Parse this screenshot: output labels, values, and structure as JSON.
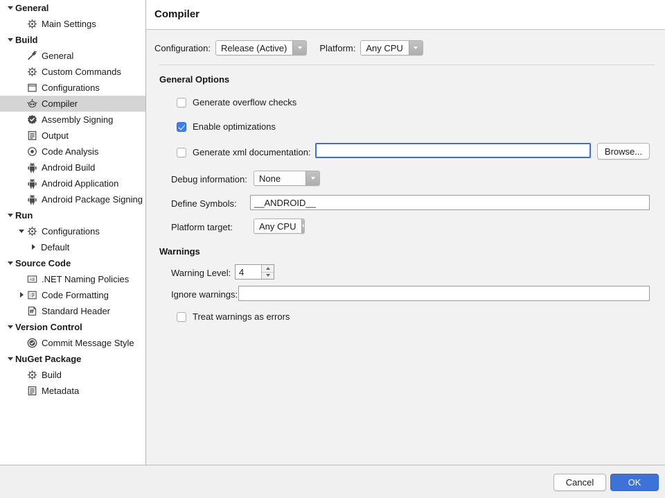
{
  "header": {
    "title": "Compiler"
  },
  "sidebar": {
    "items": [
      {
        "label": "General",
        "level": 0,
        "twisty": "down",
        "bold": true,
        "icon": null,
        "selected": false
      },
      {
        "label": "Main Settings",
        "level": 1,
        "twisty": null,
        "bold": false,
        "icon": "gear-icon",
        "selected": false
      },
      {
        "label": "Build",
        "level": 0,
        "twisty": "down",
        "bold": true,
        "icon": null,
        "selected": false
      },
      {
        "label": "General",
        "level": 1,
        "twisty": null,
        "bold": false,
        "icon": "hammer-icon",
        "selected": false
      },
      {
        "label": "Custom Commands",
        "level": 1,
        "twisty": null,
        "bold": false,
        "icon": "gear-icon",
        "selected": false
      },
      {
        "label": "Configurations",
        "level": 1,
        "twisty": null,
        "bold": false,
        "icon": "window-icon",
        "selected": false
      },
      {
        "label": "Compiler",
        "level": 1,
        "twisty": null,
        "bold": false,
        "icon": "compiler-icon",
        "selected": true
      },
      {
        "label": "Assembly Signing",
        "level": 1,
        "twisty": null,
        "bold": false,
        "icon": "badge-check-icon",
        "selected": false
      },
      {
        "label": "Output",
        "level": 1,
        "twisty": null,
        "bold": false,
        "icon": "document-icon",
        "selected": false
      },
      {
        "label": "Code Analysis",
        "level": 1,
        "twisty": null,
        "bold": false,
        "icon": "target-icon",
        "selected": false
      },
      {
        "label": "Android Build",
        "level": 1,
        "twisty": null,
        "bold": false,
        "icon": "android-icon",
        "selected": false
      },
      {
        "label": "Android Application",
        "level": 1,
        "twisty": null,
        "bold": false,
        "icon": "android-icon",
        "selected": false
      },
      {
        "label": "Android Package Signing",
        "level": 1,
        "twisty": null,
        "bold": false,
        "icon": "android-icon",
        "selected": false
      },
      {
        "label": "Run",
        "level": 0,
        "twisty": "down",
        "bold": true,
        "icon": null,
        "selected": false
      },
      {
        "label": "Configurations",
        "level": 1,
        "twisty": "down",
        "bold": false,
        "icon": "gear-icon",
        "selected": false
      },
      {
        "label": "Default",
        "level": 2,
        "twisty": "right",
        "bold": false,
        "icon": null,
        "selected": false
      },
      {
        "label": "Source Code",
        "level": 0,
        "twisty": "down",
        "bold": true,
        "icon": null,
        "selected": false
      },
      {
        "label": ".NET Naming Policies",
        "level": 1,
        "twisty": null,
        "bold": false,
        "icon": "ab-icon",
        "selected": false
      },
      {
        "label": "Code Formatting",
        "level": 1,
        "twisty": "right",
        "bold": false,
        "icon": "list-box-icon",
        "selected": false
      },
      {
        "label": "Standard Header",
        "level": 1,
        "twisty": null,
        "bold": false,
        "icon": "hash-page-icon",
        "selected": false
      },
      {
        "label": "Version Control",
        "level": 0,
        "twisty": "down",
        "bold": true,
        "icon": null,
        "selected": false
      },
      {
        "label": "Commit Message Style",
        "level": 1,
        "twisty": null,
        "bold": false,
        "icon": "check-circle-icon",
        "selected": false
      },
      {
        "label": "NuGet Package",
        "level": 0,
        "twisty": "down",
        "bold": true,
        "icon": null,
        "selected": false
      },
      {
        "label": "Build",
        "level": 1,
        "twisty": null,
        "bold": false,
        "icon": "gear-icon",
        "selected": false
      },
      {
        "label": "Metadata",
        "level": 1,
        "twisty": null,
        "bold": false,
        "icon": "document-icon",
        "selected": false
      }
    ]
  },
  "config_row": {
    "configuration_label": "Configuration:",
    "configuration_value": "Release (Active)",
    "platform_label": "Platform:",
    "platform_value": "Any CPU"
  },
  "general_options": {
    "title": "General Options",
    "overflow_checks_label": "Generate overflow checks",
    "overflow_checks_value": false,
    "optimizations_label": "Enable optimizations",
    "optimizations_value": true,
    "xmldoc_label": "Generate xml documentation:",
    "xmldoc_value": false,
    "xmldoc_path": "",
    "browse_label": "Browse...",
    "debug_info_label": "Debug information:",
    "debug_info_value": "None",
    "define_symbols_label": "Define Symbols:",
    "define_symbols_value": "__ANDROID__",
    "platform_target_label": "Platform target:",
    "platform_target_value": "Any CPU"
  },
  "warnings": {
    "title": "Warnings",
    "warning_level_label": "Warning Level:",
    "warning_level_value": "4",
    "ignore_warnings_label": "Ignore warnings:",
    "ignore_warnings_value": "",
    "treat_as_errors_label": "Treat warnings as errors",
    "treat_as_errors_value": false
  },
  "footer": {
    "cancel_label": "Cancel",
    "ok_label": "OK"
  },
  "colors": {
    "accent": "#3d72d8",
    "checkbox_on": "#3d7ef0",
    "focus_border": "#3b6fe0",
    "selection": "#d4d4d4",
    "sidebar_bg": "#ffffff",
    "content_bg": "#f2f2f2"
  }
}
